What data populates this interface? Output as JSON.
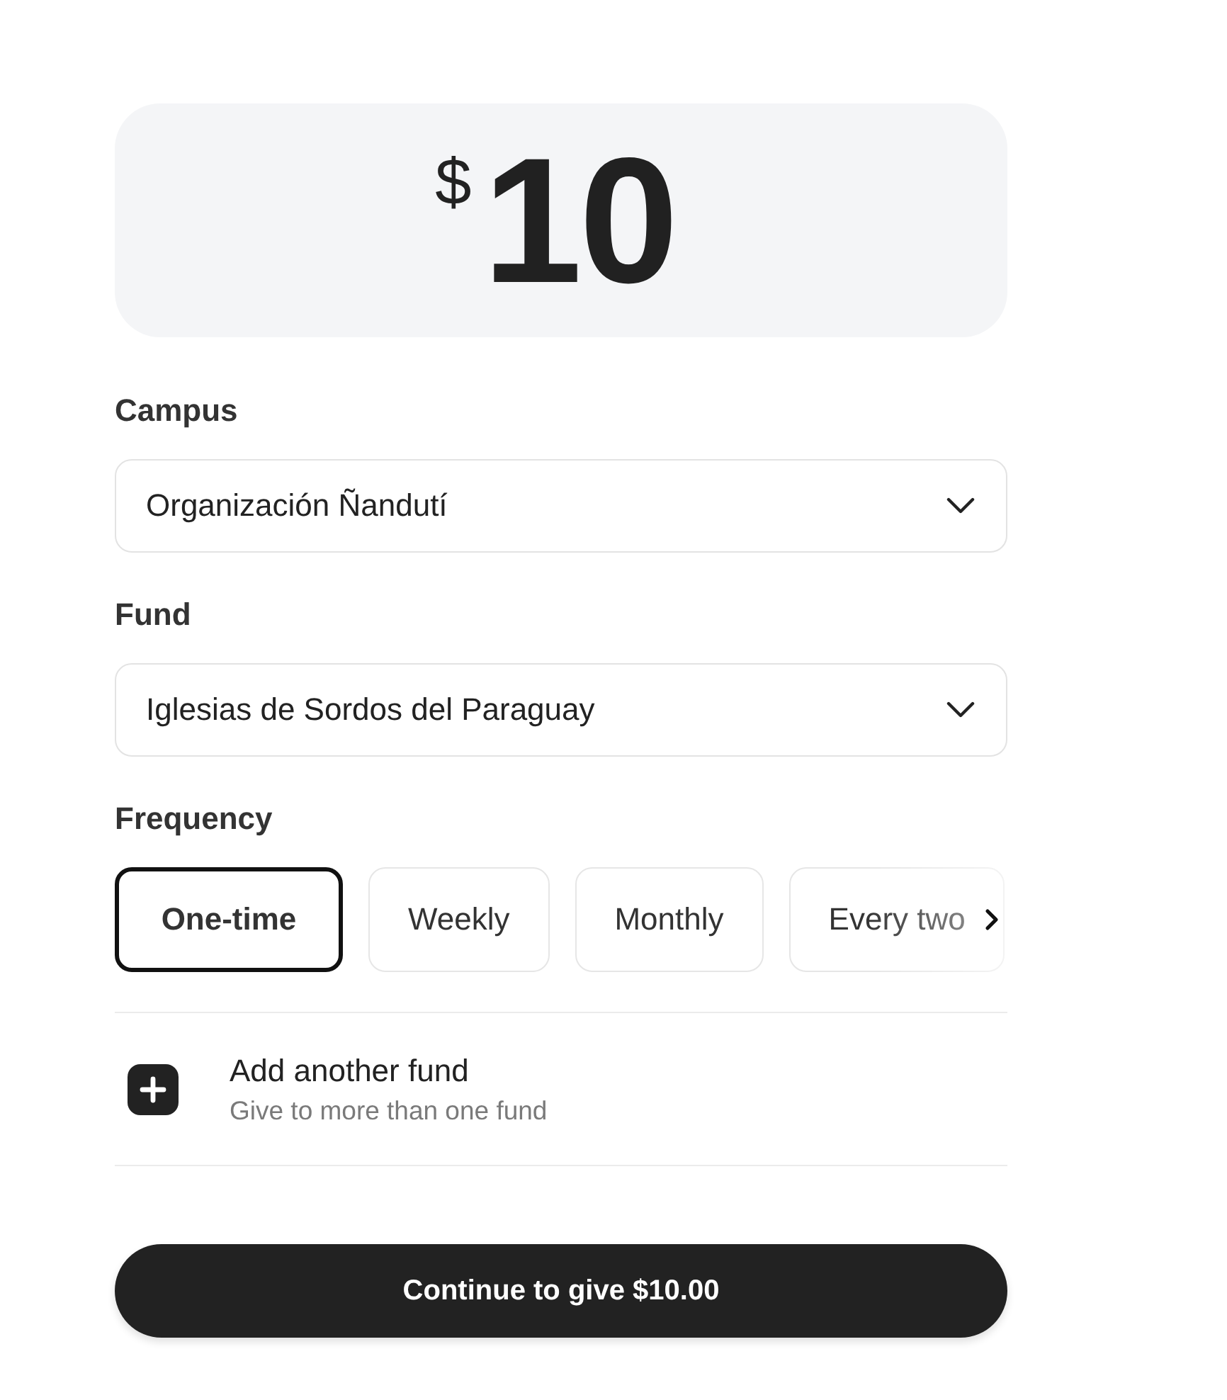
{
  "amount": {
    "currency_symbol": "$",
    "value": "10"
  },
  "campus": {
    "label": "Campus",
    "value": "Organización Ñandutí"
  },
  "fund": {
    "label": "Fund",
    "value": "Iglesias de Sordos del Paraguay"
  },
  "frequency": {
    "label": "Frequency",
    "options": [
      {
        "label": "One-time",
        "selected": true
      },
      {
        "label": "Weekly",
        "selected": false
      },
      {
        "label": "Monthly",
        "selected": false
      },
      {
        "label": "Every two",
        "selected": false
      }
    ]
  },
  "add_fund": {
    "title": "Add another fund",
    "subtitle": "Give to more than one fund"
  },
  "submit": {
    "label": "Continue to give $10.00"
  }
}
